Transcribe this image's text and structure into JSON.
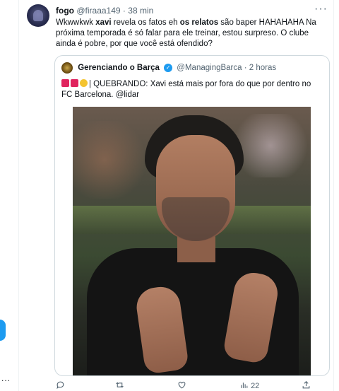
{
  "tweet": {
    "author_name": "fogo",
    "author_handle": "@firaaa149",
    "separator": "·",
    "time": "38 min",
    "text_prefix": "Wkwwkwk ",
    "text_bold1": "xavi",
    "text_mid": " revela os fatos eh ",
    "text_bold2": "os relatos",
    "text_rest": " são baper HAHAHAHA Na próxima temporada é só falar para ele treinar, estou surpreso. O clube ainda é pobre, por que você está ofendido?",
    "more_label": "···"
  },
  "quote": {
    "author_name": "Gerenciando o Barça",
    "verified_mark": "✓",
    "author_handle": "@ManagingBarca",
    "separator": "·",
    "time": "2 horas",
    "text": "| QUEBRANDO: Xavi está mais por fora do que por dentro no FC Barcelona. @lidar",
    "photo_description": "Xavi applauding"
  },
  "actions": {
    "reply_count": "",
    "retweet_count": "",
    "like_count": "",
    "views_count": "22"
  },
  "left_rail": {
    "more_label": "..."
  },
  "colors": {
    "accent": "#1d9bf0",
    "secondary_text": "#536471",
    "border": "#cfd9de"
  }
}
